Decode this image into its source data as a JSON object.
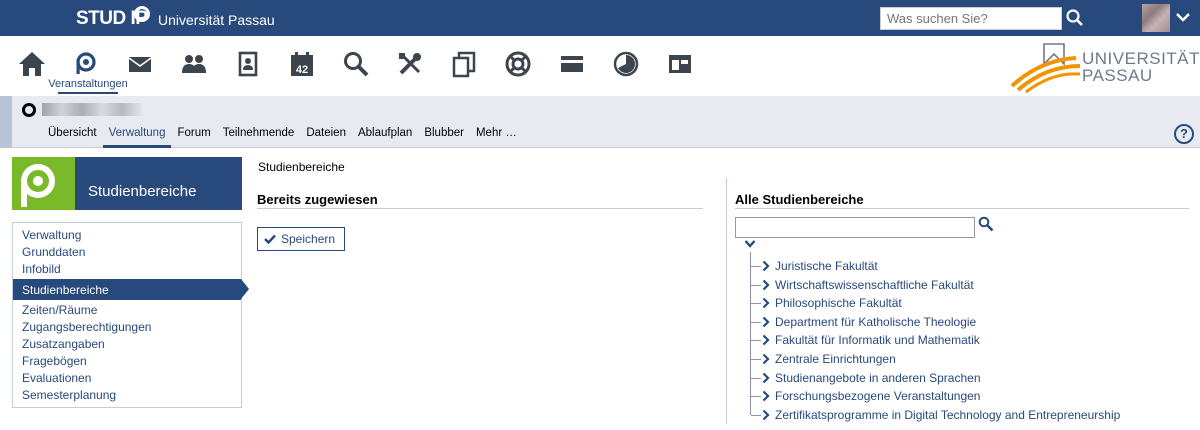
{
  "topbar": {
    "brand": "STUD IP",
    "university": "Universität Passau",
    "search_placeholder": "Was suchen Sie?"
  },
  "iconbar": {
    "icons": [
      "home-icon",
      "courses-icon",
      "mail-icon",
      "community-icon",
      "profile-icon",
      "calendar-icon",
      "search-icon",
      "tools-icon",
      "files-icon",
      "help-ring-icon",
      "card-icon",
      "pie-icon",
      "layout-icon"
    ],
    "active_label": "Veranstaltungen",
    "calendar_day": "42",
    "logo_line1": "UNIVERSITÄT",
    "logo_line2": "PASSAU"
  },
  "course": {
    "tabs": [
      "Übersicht",
      "Verwaltung",
      "Forum",
      "Teilnehmende",
      "Dateien",
      "Ablaufplan",
      "Blubber",
      "Mehr …"
    ],
    "active_tab": "Verwaltung",
    "help": "?"
  },
  "sidebar": {
    "title": "Studienbereiche",
    "items": [
      "Verwaltung",
      "Grunddaten",
      "Infobild",
      "Studienbereiche",
      "Zeiten/Räume",
      "Zugangsberechtigungen",
      "Zusatzangaben",
      "Fragebögen",
      "Evaluationen",
      "Semesterplanung"
    ],
    "active_index": 3
  },
  "main": {
    "breadcrumb": "Studienbereiche",
    "assigned_title": "Bereits zugewiesen",
    "save_label": "Speichern",
    "all_title": "Alle Studienbereiche",
    "tree_items": [
      "Juristische Fakultät",
      "Wirtschaftswissenschaftliche Fakultät",
      "Philosophische Fakultät",
      "Department für Katholische Theologie",
      "Fakultät für Informatik und Mathematik",
      "Zentrale Einrichtungen",
      "Studienangebote in anderen Sprachen",
      "Forschungsbezogene Veranstaltungen",
      "Zertifikatsprogramme in Digital Technology and Entrepreneurship"
    ]
  },
  "colors": {
    "primary": "#28497c",
    "accent_green": "#7ab929",
    "logo_orange": "#f29400"
  }
}
